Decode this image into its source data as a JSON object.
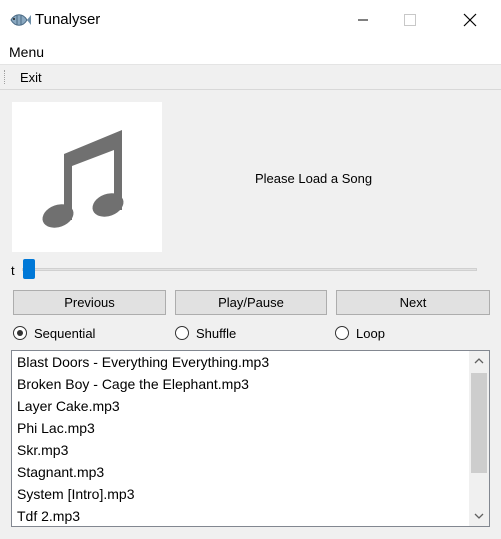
{
  "window": {
    "title": "Tunalyser"
  },
  "menu": {
    "label": "Menu"
  },
  "toolbar": {
    "exit_label": "Exit"
  },
  "player": {
    "status": "Please Load a Song",
    "slider_label": "t",
    "position_fraction": 0.0
  },
  "controls": {
    "previous": "Previous",
    "play_pause": "Play/Pause",
    "next": "Next"
  },
  "modes": {
    "sequential": {
      "label": "Sequential",
      "checked": true
    },
    "shuffle": {
      "label": "Shuffle",
      "checked": false
    },
    "loop": {
      "label": "Loop",
      "checked": false
    }
  },
  "playlist": {
    "items": [
      "Blast Doors - Everything Everything.mp3",
      "Broken Boy - Cage the Elephant.mp3",
      "Layer Cake.mp3",
      "Phi Lac.mp3",
      "Skr.mp3",
      "Stagnant.mp3",
      "System [Intro].mp3",
      "Tdf 2.mp3"
    ]
  },
  "icons": {
    "app": "fish-icon",
    "cover": "music-note-icon",
    "minimize": "minimize-icon",
    "maximize": "maximize-icon",
    "close": "close-icon"
  },
  "colors": {
    "accent": "#0078d7",
    "cover_icon": "#707070"
  }
}
